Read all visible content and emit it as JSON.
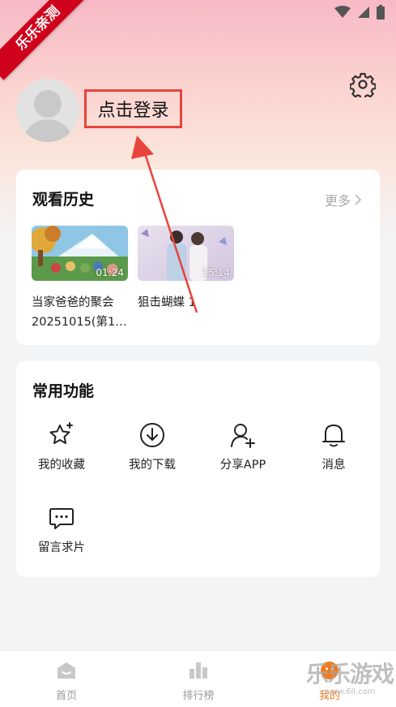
{
  "watermark_ribbon": "乐乐亲测",
  "profile": {
    "login_label": "点击登录"
  },
  "history": {
    "title": "观看历史",
    "more_label": "更多",
    "items": [
      {
        "title": "当家爸爸的聚会20251015(第1…",
        "duration": "01:24"
      },
      {
        "title": "狙击蝴蝶 1",
        "duration": "15:14"
      }
    ]
  },
  "functions": {
    "title": "常用功能",
    "items": [
      {
        "label": "我的收藏",
        "icon": "star-sparkle-icon"
      },
      {
        "label": "我的下载",
        "icon": "download-icon"
      },
      {
        "label": "分享APP",
        "icon": "add-user-icon"
      },
      {
        "label": "消息",
        "icon": "bell-icon"
      },
      {
        "label": "留言求片",
        "icon": "chat-bubble-icon"
      }
    ]
  },
  "tabbar": {
    "items": [
      {
        "label": "首页",
        "icon": "home-icon"
      },
      {
        "label": "排行榜",
        "icon": "bar-chart-icon"
      },
      {
        "label": "我的",
        "icon": "profile-icon",
        "active": true
      }
    ]
  },
  "site_watermark": {
    "brand": "乐乐游戏",
    "url": "www.6ll.com"
  },
  "colors": {
    "accent": "#f07b1e",
    "highlight_box": "#e8443d",
    "ribbon": "#d0021b"
  }
}
